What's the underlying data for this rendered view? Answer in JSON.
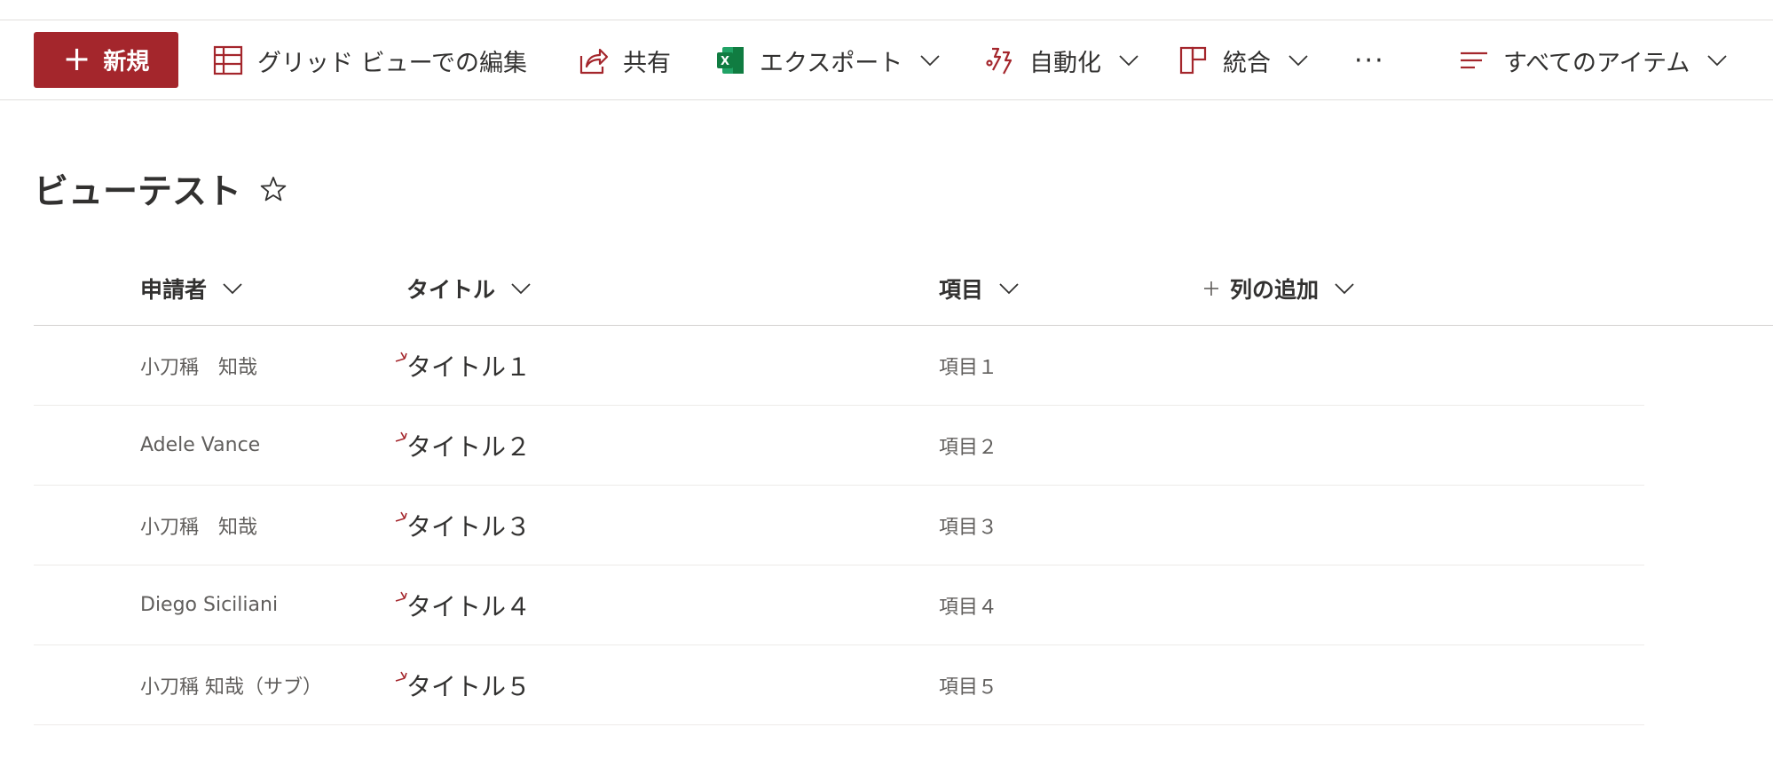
{
  "toolbar": {
    "new_label": "新規",
    "grid_edit_label": "グリッド ビューでの編集",
    "share_label": "共有",
    "export_label": "エクスポート",
    "automate_label": "自動化",
    "integrate_label": "統合",
    "more_label": "···",
    "view_label": "すべてのアイテム"
  },
  "page": {
    "title": "ビューテスト"
  },
  "columns": {
    "applicant": "申請者",
    "title": "タイトル",
    "item": "項目",
    "add_column": "列の追加"
  },
  "rows": [
    {
      "applicant": "小刀稱　知哉",
      "title": "タイトル１",
      "item": "項目１"
    },
    {
      "applicant": "Adele Vance",
      "title": "タイトル２",
      "item": "項目２"
    },
    {
      "applicant": "小刀稱　知哉",
      "title": "タイトル３",
      "item": "項目３"
    },
    {
      "applicant": "Diego Siciliani",
      "title": "タイトル４",
      "item": "項目４"
    },
    {
      "applicant": "小刀稱 知哉（サブ）",
      "title": "タイトル５",
      "item": "項目５"
    }
  ],
  "icons": {
    "new": "plus-icon",
    "grid_edit": "grid-icon",
    "share": "share-icon",
    "export": "excel-icon",
    "automate": "flow-icon",
    "integrate": "integrate-icon",
    "view": "list-lines-icon",
    "favorite": "star-icon",
    "new_item_marker": "new-item-icon"
  },
  "colors": {
    "accent": "#a4262c",
    "excel_green": "#107c41",
    "text": "#323130",
    "subtle_text": "#605e5c"
  }
}
